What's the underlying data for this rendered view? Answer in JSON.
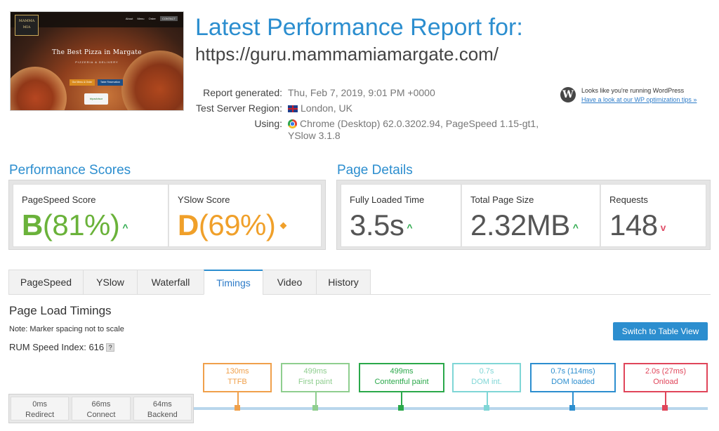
{
  "thumbnail": {
    "logo": "MAMMA MIA",
    "nav": [
      "About",
      "Menu",
      "Order",
      "CONTACT"
    ],
    "headline": "The Best Pizza in Margate",
    "sub": "PIZZERIA & DELIVERY",
    "btn1": "Our Menu & Order",
    "btn2": "Table Reservation",
    "badge": "tripadvisor"
  },
  "header": {
    "title": "Latest Performance Report for:",
    "url": "https://guru.mammamiamargate.com/"
  },
  "meta": {
    "generated_label": "Report generated:",
    "generated_value": "Thu, Feb 7, 2019, 9:01 PM +0000",
    "region_label": "Test Server Region:",
    "region_value": "London, UK",
    "using_label": "Using:",
    "using_value": "Chrome (Desktop) 62.0.3202.94, PageSpeed 1.15-gt1, YSlow 3.1.8"
  },
  "wordpress": {
    "icon": "wordpress-icon",
    "line1": "Looks like you're running WordPress",
    "line2": "Have a look at our WP optimization tips »"
  },
  "performance": {
    "title": "Performance Scores",
    "pagespeed_label": "PageSpeed Score",
    "pagespeed_grade": "B",
    "pagespeed_pct": "(81%)",
    "yslow_label": "YSlow Score",
    "yslow_grade": "D",
    "yslow_pct": "(69%)"
  },
  "details": {
    "title": "Page Details",
    "loaded_label": "Fully Loaded Time",
    "loaded_value": "3.5s",
    "size_label": "Total Page Size",
    "size_value": "2.32MB",
    "requests_label": "Requests",
    "requests_value": "148"
  },
  "tabs": [
    "PageSpeed",
    "YSlow",
    "Waterfall",
    "Timings",
    "Video",
    "History"
  ],
  "active_tab": "Timings",
  "timings": {
    "title": "Page Load Timings",
    "note": "Note: Marker spacing not to scale",
    "rum_label": "RUM Speed Index: 616",
    "rum_help": "?",
    "switch_button": "Switch to Table View",
    "backend": [
      {
        "value": "0ms",
        "label": "Redirect"
      },
      {
        "value": "66ms",
        "label": "Connect"
      },
      {
        "value": "64ms",
        "label": "Backend"
      }
    ],
    "markers": [
      {
        "value": "130ms",
        "label": "TTFB",
        "color": "#f0a04b"
      },
      {
        "value": "499ms",
        "label": "First paint",
        "color": "#8fce8f"
      },
      {
        "value": "499ms",
        "label": "Contentful paint",
        "color": "#2aa84a"
      },
      {
        "value": "0.7s",
        "label": "DOM int.",
        "color": "#7fd6d6"
      },
      {
        "value": "0.7s (114ms)",
        "label": "DOM loaded",
        "color": "#2c8ecf"
      },
      {
        "value": "2.0s (27ms)",
        "label": "Onload",
        "color": "#e0455a"
      }
    ]
  },
  "colors": {
    "brand_blue": "#2c8ecf",
    "grade_b": "#6ab23a",
    "grade_d": "#f0a02a",
    "up_arrow": "#2aa84a",
    "down_arrow": "#e0506a"
  }
}
